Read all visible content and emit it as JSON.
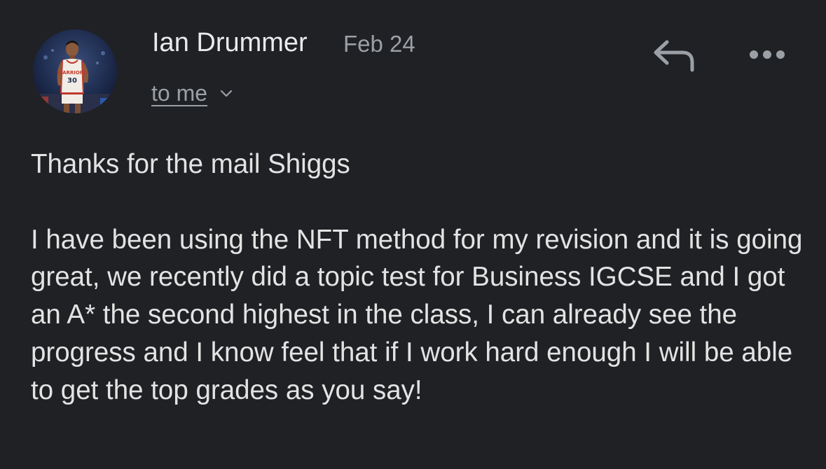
{
  "email": {
    "sender_name": "Ian Drummer",
    "date": "Feb 24",
    "recipient_label": "to me",
    "greeting": "Thanks for the mail Shiggs",
    "body": "I have been using the NFT method for my revision and it is going great, we recently did a topic test for Business IGCSE and I got an A* the second highest in the class, I can already see the progress and I know feel that if I work hard enough I will be able to get the top grades as you say!",
    "avatar_jersey_number": "30"
  },
  "icons": {
    "reply": "reply-arrow-icon",
    "more": "more-horizontal-icon",
    "expand": "chevron-down-icon"
  },
  "colors": {
    "background": "#202124",
    "primary_text": "#e3e3e3",
    "secondary_text": "#9aa0a6"
  }
}
